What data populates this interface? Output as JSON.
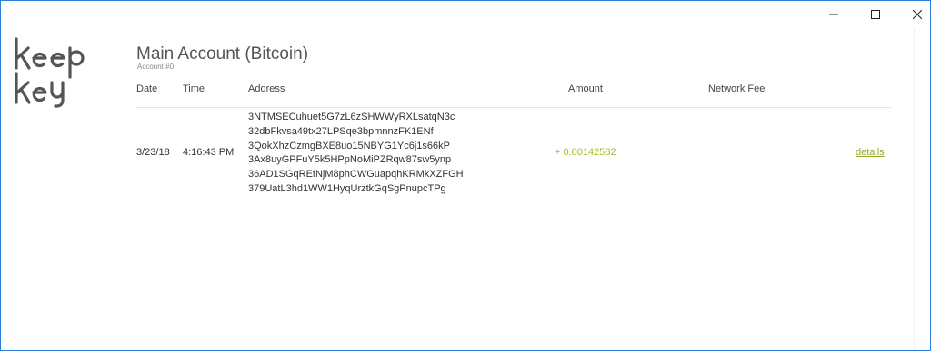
{
  "window": {
    "controls": {
      "minimize_icon": "minimize-icon",
      "maximize_icon": "maximize-icon",
      "close_icon": "close-icon"
    }
  },
  "logo": {
    "text": "keepkey",
    "icon": "keepkey-logo"
  },
  "account": {
    "title": "Main Account (Bitcoin)",
    "subtitle": "Account #0"
  },
  "table": {
    "headers": {
      "date": "Date",
      "time": "Time",
      "address": "Address",
      "amount": "Amount",
      "network_fee": "Network Fee"
    },
    "rows": [
      {
        "date": "3/23/18",
        "time": "4:16:43 PM",
        "addresses": [
          "3NTMSECuhuet5G7zL6zSHWWyRXLsatqN3c",
          "32dbFkvsa49tx27LPSqe3bpmnnzFK1ENf",
          "3QokXhzCzmgBXE8uo15NBYG1Yc6j1s66kP",
          "3Ax8uyGPFuY5k5HPpNoMiPZRqw87sw5ynp",
          "36AD1SGqREtNjM8phCWGuapqhKRMkXZFGH",
          "379UatL3hd1WW1HyqUrztkGqSgPnupcTPg"
        ],
        "amount": "+ 0.00142582",
        "network_fee": "",
        "details_label": "details"
      }
    ]
  },
  "colors": {
    "amount": "#a8c026",
    "link": "#9aa82a",
    "window_border": "#2b7fd9"
  }
}
